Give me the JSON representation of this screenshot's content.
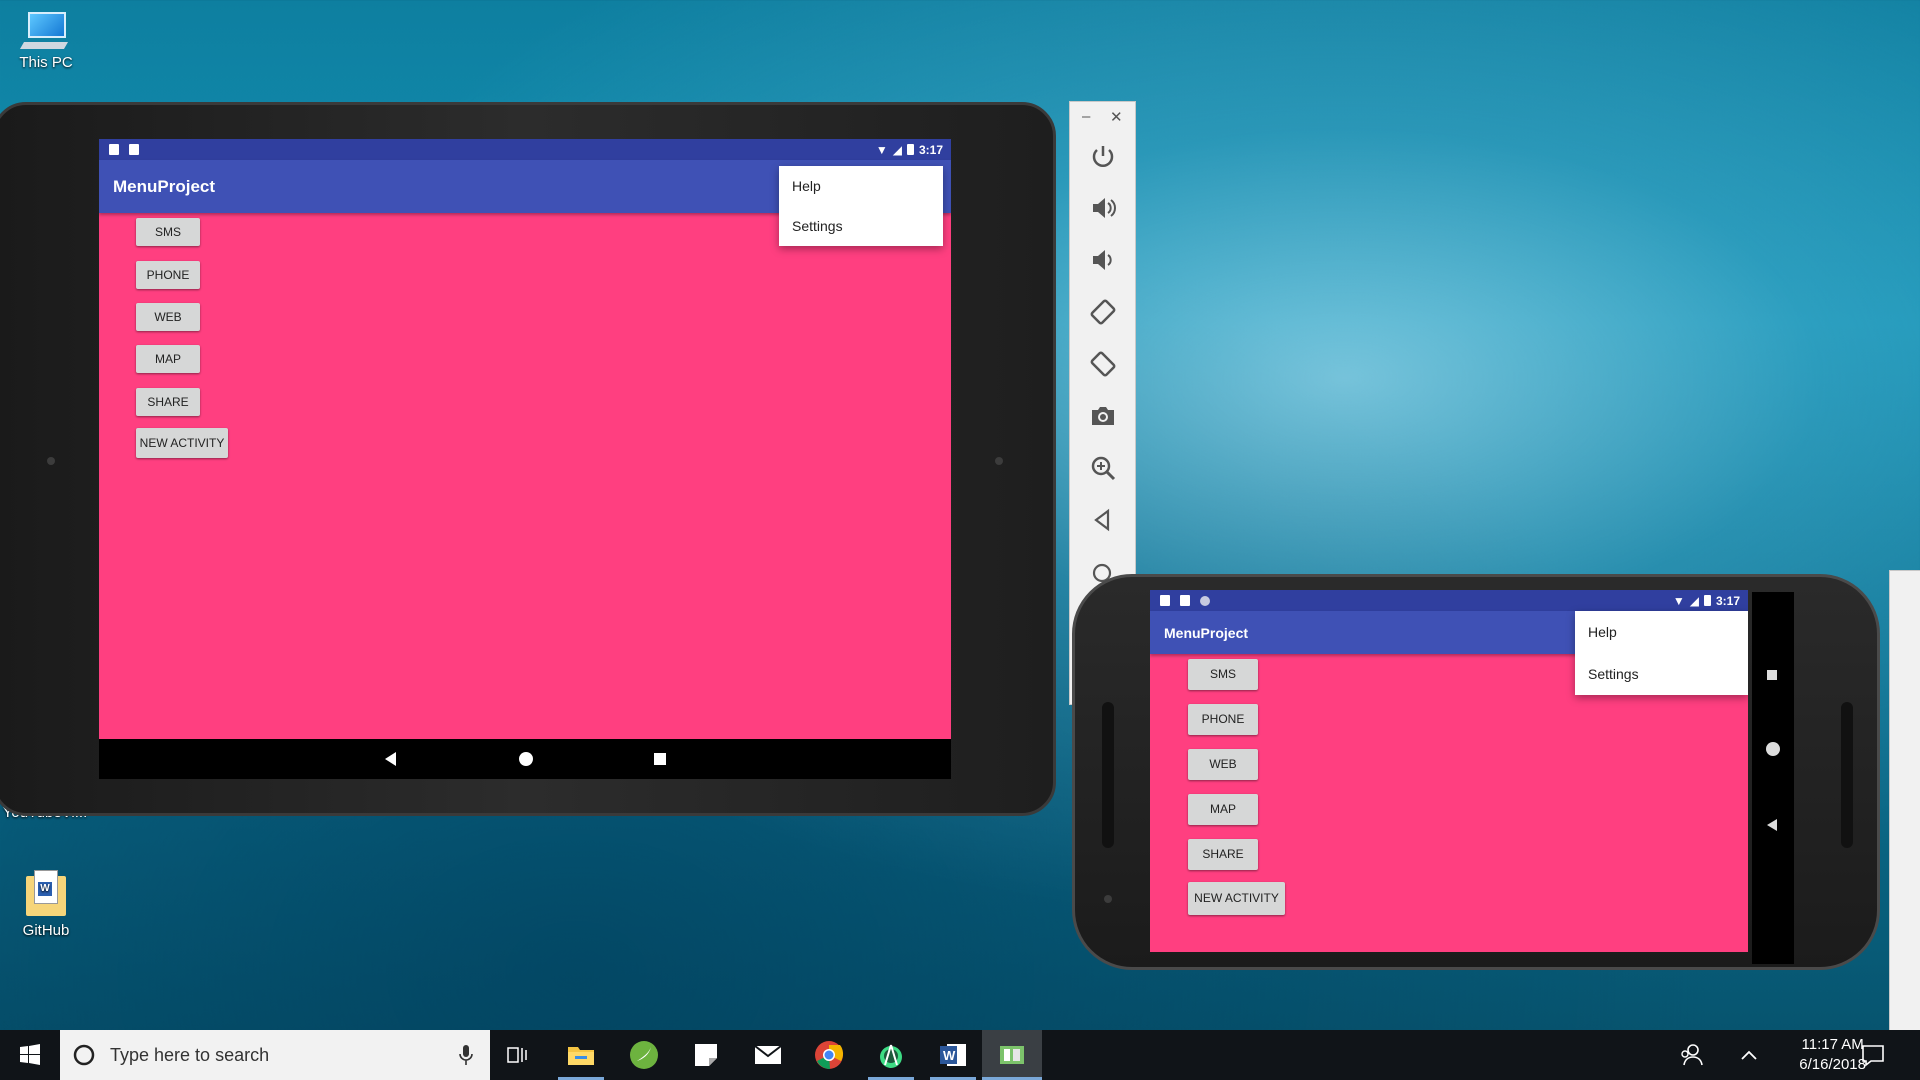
{
  "desktop": {
    "icons": [
      {
        "label": "This PC"
      },
      {
        "label": "YouTubeVi..."
      },
      {
        "label": "GitHub"
      }
    ]
  },
  "tablet": {
    "status_time": "3:17",
    "app_title": "MenuProject",
    "menu": [
      "Help",
      "Settings"
    ],
    "buttons": [
      "SMS",
      "PHONE",
      "WEB",
      "MAP",
      "SHARE",
      "NEW ACTIVITY"
    ]
  },
  "phone": {
    "status_time": "3:17",
    "app_title": "MenuProject",
    "menu": [
      "Help",
      "Settings"
    ],
    "buttons": [
      "SMS",
      "PHONE",
      "WEB",
      "MAP",
      "SHARE",
      "NEW ACTIVITY"
    ]
  },
  "emulator_toolbar": {
    "minimize": "–",
    "close": "✕",
    "tools": [
      "power-icon",
      "volume-up-icon",
      "volume-down-icon",
      "rotate-left-icon",
      "rotate-right-icon",
      "camera-icon",
      "zoom-icon",
      "back-icon",
      "search-icon"
    ]
  },
  "taskbar": {
    "search_placeholder": "Type here to search",
    "time": "11:17 AM",
    "date": "6/16/2018",
    "apps": [
      "task-view-icon",
      "file-explorer-icon",
      "spring-icon",
      "sticky-notes-icon",
      "mail-icon",
      "chrome-icon",
      "android-studio-icon",
      "word-icon",
      "emulator-icon"
    ]
  },
  "colors": {
    "android_accent": "#ff3f80",
    "app_bar": "#3f51b5",
    "status_bar": "#303f9f"
  }
}
